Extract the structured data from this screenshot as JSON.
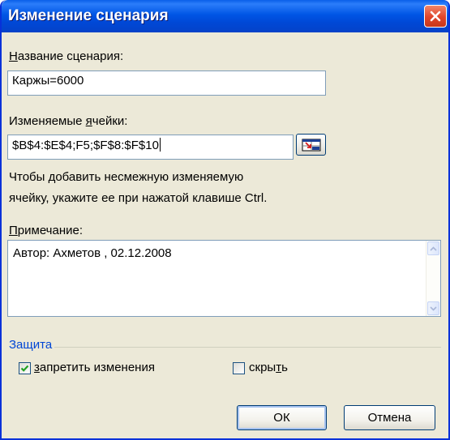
{
  "window": {
    "title": "Изменение сценария",
    "close_icon": "close-icon"
  },
  "scenario_name": {
    "label_accel": "Н",
    "label_rest": "азвание сценария:",
    "value": "Каржы=6000"
  },
  "changing_cells": {
    "label_pre": "Изменяемые ",
    "label_accel": "я",
    "label_rest": "чейки:",
    "value": "$B$4:$E$4;F5;$F$8:$F$10",
    "refedit_icon": "collapse-dialog-icon"
  },
  "hint": {
    "line1": "Чтобы добавить несмежную изменяемую",
    "line2": "ячейку, укажите ее при нажатой клавише Ctrl."
  },
  "comment": {
    "label_accel": "П",
    "label_rest": "римечание:",
    "value": "Автор: Ахметов , 02.12.2008"
  },
  "protection": {
    "group_title": "Защита",
    "prevent_changes": {
      "label_accel": "з",
      "label_rest": "апретить изменения",
      "checked": true
    },
    "hide": {
      "label_pre": "скры",
      "label_accel": "т",
      "label_rest": "ь",
      "checked": false
    }
  },
  "buttons": {
    "ok": "ОК",
    "cancel": "Отмена"
  },
  "colors": {
    "title_bar": "#0055e5",
    "dialog_bg": "#ece9d8",
    "group_title": "#0046d5",
    "check_mark": "#21a121"
  }
}
